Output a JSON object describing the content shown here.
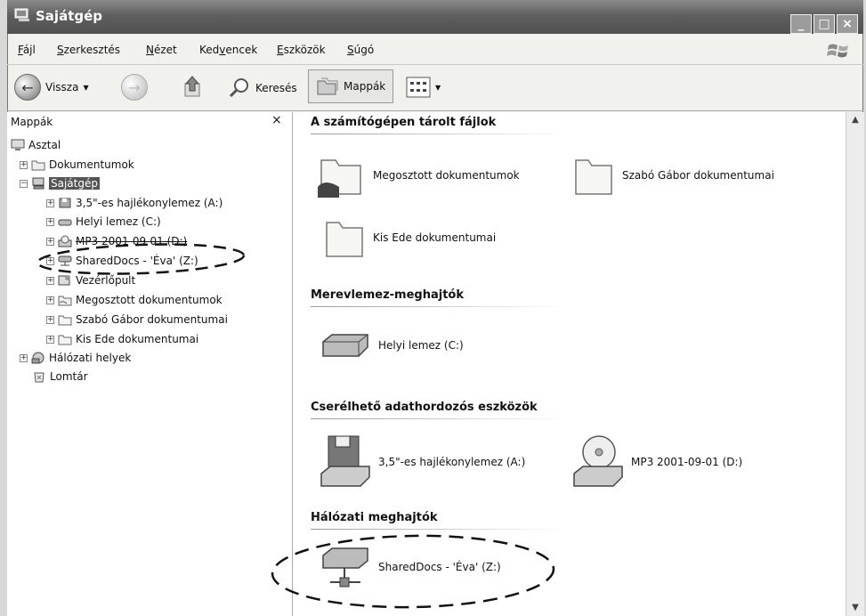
{
  "window": {
    "title": "Sajátgép"
  },
  "menu": [
    {
      "pre": "",
      "key": "F",
      "post": "ájl"
    },
    {
      "pre": "",
      "key": "S",
      "post": "zerkesztés"
    },
    {
      "pre": "",
      "key": "N",
      "post": "ézet"
    },
    {
      "pre": "Ked",
      "key": "v",
      "post": "encek"
    },
    {
      "pre": "",
      "key": "E",
      "post": "szközök"
    },
    {
      "pre": "",
      "key": "S",
      "post": "úgó"
    }
  ],
  "toolbar": {
    "back": "Vissza",
    "search": "Keresés",
    "folders": "Mappák"
  },
  "folders_pane": {
    "header": "Mappák",
    "close": "×",
    "tree": [
      {
        "label": "Asztal",
        "icon": "desktop-icon"
      },
      {
        "label": "Dokumentumok",
        "icon": "documents-folder-icon"
      },
      {
        "label": "Sajátgép",
        "icon": "my-computer-icon"
      },
      {
        "label": "3,5\"-es hajlékonylemez (A:)",
        "icon": "floppy-drive-icon"
      },
      {
        "label": "Helyi lemez (C:)",
        "icon": "hard-drive-icon"
      },
      {
        "label": "MP3 2001-09-01 (D:)",
        "icon": "cd-drive-icon"
      },
      {
        "label": "SharedDocs - 'Éva' (Z:)",
        "icon": "network-drive-icon"
      },
      {
        "label": "Vezérlőpult",
        "icon": "control-panel-icon"
      },
      {
        "label": "Megosztott dokumentumok",
        "icon": "shared-folder-icon"
      },
      {
        "label": "Szabó Gábor dokumentumai",
        "icon": "folder-icon"
      },
      {
        "label": "Kis Ede dokumentumai",
        "icon": "folder-icon"
      },
      {
        "label": "Hálózati helyek",
        "icon": "network-places-icon"
      },
      {
        "label": "Lomtár",
        "icon": "recycle-bin-icon"
      }
    ]
  },
  "content": {
    "sections": [
      {
        "title": "A számítógépen tárolt fájlok",
        "items": [
          {
            "label": "Megosztott dokumentumok",
            "icon": "shared-folder-icon"
          },
          {
            "label": "Szabó Gábor dokumentumai",
            "icon": "folder-icon"
          },
          {
            "label": "Kis Ede dokumentumai",
            "icon": "folder-icon"
          }
        ]
      },
      {
        "title": "Merevlemez-meghajtók",
        "items": [
          {
            "label": "Helyi lemez (C:)",
            "icon": "hard-drive-icon"
          }
        ]
      },
      {
        "title": "Cserélhető adathordozós eszközök",
        "items": [
          {
            "label": "3,5\"-es hajlékonylemez (A:)",
            "icon": "floppy-drive-icon"
          },
          {
            "label": "MP3 2001-09-01 (D:)",
            "icon": "cd-drive-icon"
          }
        ]
      },
      {
        "title": "Hálózati meghajtók",
        "items": [
          {
            "label": "SharedDocs - 'Éva' (Z:)",
            "icon": "network-drive-icon"
          }
        ]
      }
    ]
  }
}
